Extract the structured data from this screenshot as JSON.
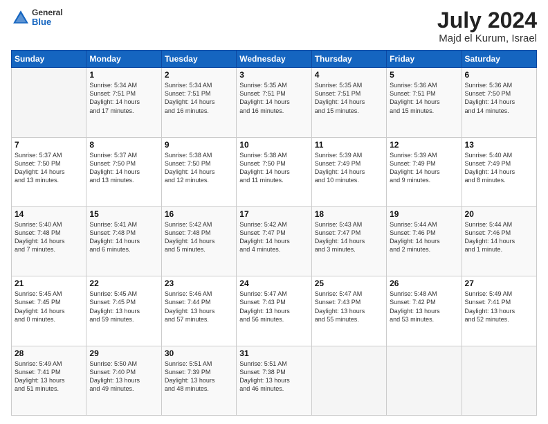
{
  "header": {
    "logo": {
      "general": "General",
      "blue": "Blue"
    },
    "title": "July 2024",
    "location": "Majd el Kurum, Israel"
  },
  "weekdays": [
    "Sunday",
    "Monday",
    "Tuesday",
    "Wednesday",
    "Thursday",
    "Friday",
    "Saturday"
  ],
  "weeks": [
    [
      {
        "day": "",
        "info": ""
      },
      {
        "day": "1",
        "info": "Sunrise: 5:34 AM\nSunset: 7:51 PM\nDaylight: 14 hours\nand 17 minutes."
      },
      {
        "day": "2",
        "info": "Sunrise: 5:34 AM\nSunset: 7:51 PM\nDaylight: 14 hours\nand 16 minutes."
      },
      {
        "day": "3",
        "info": "Sunrise: 5:35 AM\nSunset: 7:51 PM\nDaylight: 14 hours\nand 16 minutes."
      },
      {
        "day": "4",
        "info": "Sunrise: 5:35 AM\nSunset: 7:51 PM\nDaylight: 14 hours\nand 15 minutes."
      },
      {
        "day": "5",
        "info": "Sunrise: 5:36 AM\nSunset: 7:51 PM\nDaylight: 14 hours\nand 15 minutes."
      },
      {
        "day": "6",
        "info": "Sunrise: 5:36 AM\nSunset: 7:50 PM\nDaylight: 14 hours\nand 14 minutes."
      }
    ],
    [
      {
        "day": "7",
        "info": "Sunrise: 5:37 AM\nSunset: 7:50 PM\nDaylight: 14 hours\nand 13 minutes."
      },
      {
        "day": "8",
        "info": "Sunrise: 5:37 AM\nSunset: 7:50 PM\nDaylight: 14 hours\nand 13 minutes."
      },
      {
        "day": "9",
        "info": "Sunrise: 5:38 AM\nSunset: 7:50 PM\nDaylight: 14 hours\nand 12 minutes."
      },
      {
        "day": "10",
        "info": "Sunrise: 5:38 AM\nSunset: 7:50 PM\nDaylight: 14 hours\nand 11 minutes."
      },
      {
        "day": "11",
        "info": "Sunrise: 5:39 AM\nSunset: 7:49 PM\nDaylight: 14 hours\nand 10 minutes."
      },
      {
        "day": "12",
        "info": "Sunrise: 5:39 AM\nSunset: 7:49 PM\nDaylight: 14 hours\nand 9 minutes."
      },
      {
        "day": "13",
        "info": "Sunrise: 5:40 AM\nSunset: 7:49 PM\nDaylight: 14 hours\nand 8 minutes."
      }
    ],
    [
      {
        "day": "14",
        "info": "Sunrise: 5:40 AM\nSunset: 7:48 PM\nDaylight: 14 hours\nand 7 minutes."
      },
      {
        "day": "15",
        "info": "Sunrise: 5:41 AM\nSunset: 7:48 PM\nDaylight: 14 hours\nand 6 minutes."
      },
      {
        "day": "16",
        "info": "Sunrise: 5:42 AM\nSunset: 7:48 PM\nDaylight: 14 hours\nand 5 minutes."
      },
      {
        "day": "17",
        "info": "Sunrise: 5:42 AM\nSunset: 7:47 PM\nDaylight: 14 hours\nand 4 minutes."
      },
      {
        "day": "18",
        "info": "Sunrise: 5:43 AM\nSunset: 7:47 PM\nDaylight: 14 hours\nand 3 minutes."
      },
      {
        "day": "19",
        "info": "Sunrise: 5:44 AM\nSunset: 7:46 PM\nDaylight: 14 hours\nand 2 minutes."
      },
      {
        "day": "20",
        "info": "Sunrise: 5:44 AM\nSunset: 7:46 PM\nDaylight: 14 hours\nand 1 minute."
      }
    ],
    [
      {
        "day": "21",
        "info": "Sunrise: 5:45 AM\nSunset: 7:45 PM\nDaylight: 14 hours\nand 0 minutes."
      },
      {
        "day": "22",
        "info": "Sunrise: 5:45 AM\nSunset: 7:45 PM\nDaylight: 13 hours\nand 59 minutes."
      },
      {
        "day": "23",
        "info": "Sunrise: 5:46 AM\nSunset: 7:44 PM\nDaylight: 13 hours\nand 57 minutes."
      },
      {
        "day": "24",
        "info": "Sunrise: 5:47 AM\nSunset: 7:43 PM\nDaylight: 13 hours\nand 56 minutes."
      },
      {
        "day": "25",
        "info": "Sunrise: 5:47 AM\nSunset: 7:43 PM\nDaylight: 13 hours\nand 55 minutes."
      },
      {
        "day": "26",
        "info": "Sunrise: 5:48 AM\nSunset: 7:42 PM\nDaylight: 13 hours\nand 53 minutes."
      },
      {
        "day": "27",
        "info": "Sunrise: 5:49 AM\nSunset: 7:41 PM\nDaylight: 13 hours\nand 52 minutes."
      }
    ],
    [
      {
        "day": "28",
        "info": "Sunrise: 5:49 AM\nSunset: 7:41 PM\nDaylight: 13 hours\nand 51 minutes."
      },
      {
        "day": "29",
        "info": "Sunrise: 5:50 AM\nSunset: 7:40 PM\nDaylight: 13 hours\nand 49 minutes."
      },
      {
        "day": "30",
        "info": "Sunrise: 5:51 AM\nSunset: 7:39 PM\nDaylight: 13 hours\nand 48 minutes."
      },
      {
        "day": "31",
        "info": "Sunrise: 5:51 AM\nSunset: 7:38 PM\nDaylight: 13 hours\nand 46 minutes."
      },
      {
        "day": "",
        "info": ""
      },
      {
        "day": "",
        "info": ""
      },
      {
        "day": "",
        "info": ""
      }
    ]
  ]
}
